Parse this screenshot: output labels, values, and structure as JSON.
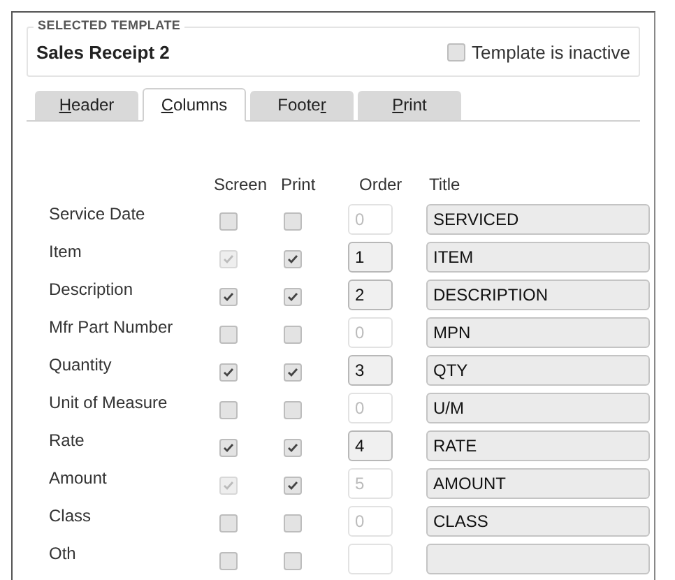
{
  "selected_template": {
    "legend": "SELECTED TEMPLATE",
    "name": "Sales Receipt 2",
    "inactive": {
      "label": "Template is inactive",
      "checked": false
    }
  },
  "tabs": [
    {
      "access_key": "H",
      "label_rest": "eader",
      "selected": false
    },
    {
      "access_key": "C",
      "label_rest": "olumns",
      "selected": true
    },
    {
      "label_lead": "Foote",
      "access_key": "r",
      "selected": false
    },
    {
      "access_key": "P",
      "label_rest": "rint",
      "selected": false
    }
  ],
  "columns": [
    "Screen",
    "Print",
    "Order",
    "Title"
  ],
  "rows": [
    {
      "label": "Service Date",
      "screen": false,
      "screen_disabled": false,
      "print": false,
      "order": "0",
      "order_disabled": true,
      "title": "SERVICED"
    },
    {
      "label": "Item",
      "screen": true,
      "screen_disabled": true,
      "print": true,
      "order": "1",
      "order_disabled": false,
      "title": "ITEM"
    },
    {
      "label": "Description",
      "screen": true,
      "screen_disabled": false,
      "print": true,
      "order": "2",
      "order_disabled": false,
      "title": "DESCRIPTION"
    },
    {
      "label": "Mfr Part Number",
      "screen": false,
      "screen_disabled": false,
      "print": false,
      "order": "0",
      "order_disabled": true,
      "title": "MPN"
    },
    {
      "label": "Quantity",
      "screen": true,
      "screen_disabled": false,
      "print": true,
      "order": "3",
      "order_disabled": false,
      "title": "QTY"
    },
    {
      "label": "Unit of Measure",
      "screen": false,
      "screen_disabled": false,
      "print": false,
      "order": "0",
      "order_disabled": true,
      "title": "U/M"
    },
    {
      "label": "Rate",
      "screen": true,
      "screen_disabled": false,
      "print": true,
      "order": "4",
      "order_disabled": false,
      "title": "RATE"
    },
    {
      "label": "Amount",
      "screen": true,
      "screen_disabled": true,
      "print": true,
      "order": "5",
      "order_disabled": true,
      "title": "AMOUNT"
    },
    {
      "label": "Class",
      "screen": false,
      "screen_disabled": false,
      "print": false,
      "order": "0",
      "order_disabled": true,
      "title": "CLASS"
    },
    {
      "label": "Oth",
      "screen": false,
      "screen_disabled": false,
      "print": false,
      "order_disabled": true
    }
  ]
}
